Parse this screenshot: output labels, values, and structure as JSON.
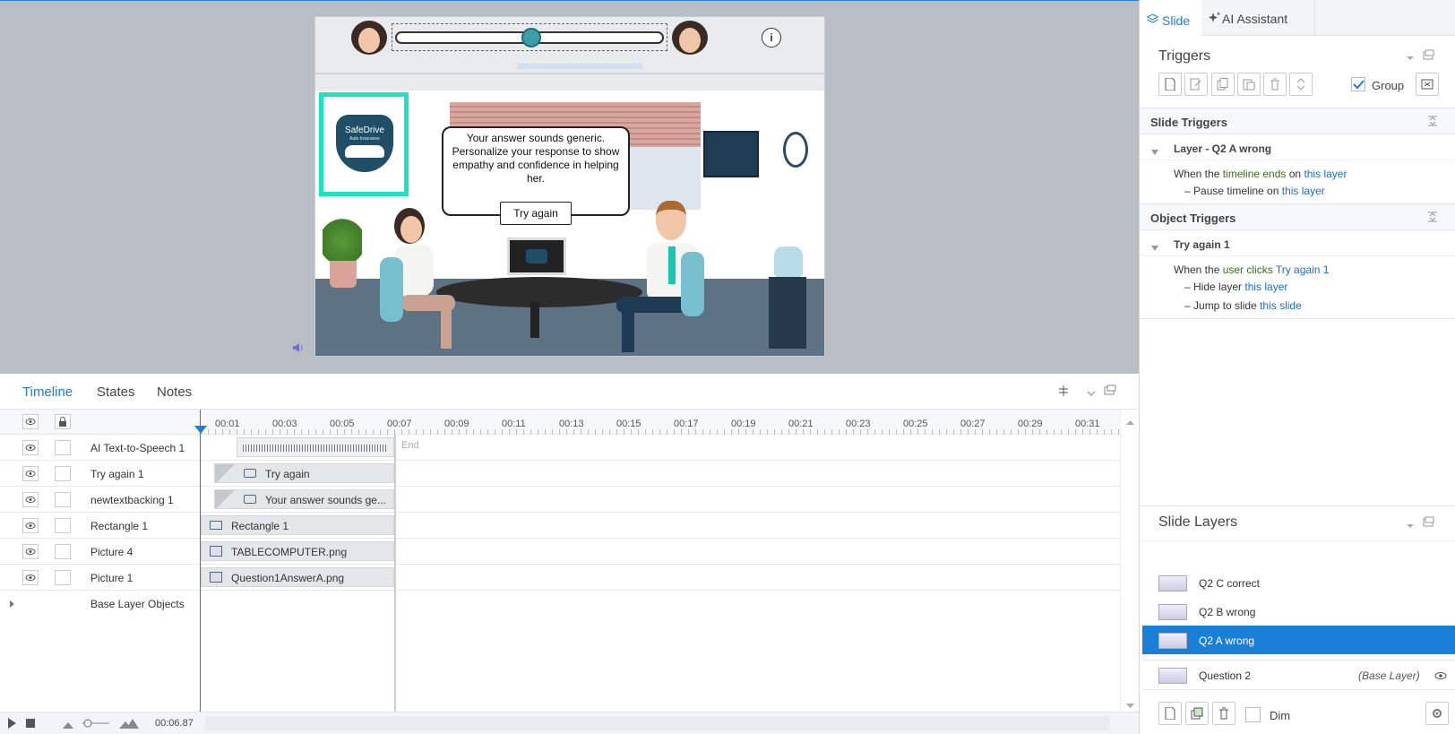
{
  "slide": {
    "callout_text": "Your answer sounds generic. Personalize your response to show empathy and confidence in helping her.",
    "try_again_label": "Try again",
    "logo_text": "SafeDrive",
    "logo_subtext": "Auto Insurance",
    "info_label": "i"
  },
  "bottom_tabs": {
    "timeline": "Timeline",
    "states": "States",
    "notes": "Notes"
  },
  "ruler": [
    "00:01",
    "00:03",
    "00:05",
    "00:07",
    "00:09",
    "00:11",
    "00:13",
    "00:15",
    "00:17",
    "00:19",
    "00:21",
    "00:23",
    "00:25",
    "00:27",
    "00:29",
    "00:31"
  ],
  "end_label": "End",
  "rows": [
    {
      "name": "AI Text-to-Speech 1",
      "bar": ""
    },
    {
      "name": "Try again 1",
      "bar": "Try again"
    },
    {
      "name": "newtextbacking 1",
      "bar": "Your answer sounds ge..."
    },
    {
      "name": "Rectangle 1",
      "bar": "Rectangle 1"
    },
    {
      "name": "Picture 4",
      "bar": "TABLECOMPUTER.png"
    },
    {
      "name": "Picture 1",
      "bar": "Question1AnswerA.png"
    }
  ],
  "base_layer_objects": "Base Layer Objects",
  "playhead_time": "00:06.87",
  "right_tabs": {
    "slide": "Slide",
    "ai": "AI Assistant"
  },
  "triggers": {
    "title": "Triggers",
    "group_label": "Group",
    "slide_triggers": "Slide Triggers",
    "layer_name": "Layer - Q2 A wrong",
    "when1_a": "When the ",
    "when1_b": "timeline ends",
    "when1_c": " on ",
    "when1_d": "this layer",
    "action1_a": "Pause timeline on ",
    "action1_b": "this layer",
    "object_triggers": "Object Triggers",
    "object_name": "Try again 1",
    "when2_a": "When the ",
    "when2_b": "user clicks",
    "when2_c": " ",
    "when2_d": "Try again 1",
    "action2_a": "Hide layer ",
    "action2_b": "this layer",
    "action3_a": "Jump to slide ",
    "action3_b": "this slide"
  },
  "layers": {
    "title": "Slide Layers",
    "items": [
      {
        "name": "Q2 C correct"
      },
      {
        "name": "Q2 B wrong"
      },
      {
        "name": "Q2 A wrong"
      },
      {
        "name": "Question 2",
        "tag": "(Base Layer)"
      }
    ],
    "dim_label": "Dim"
  },
  "colors": {
    "accent": "#1a7fd6",
    "selected_layer": "#1a7fd6",
    "stage_bg": "#b9bec4",
    "logo_border": "#19e3c1"
  }
}
